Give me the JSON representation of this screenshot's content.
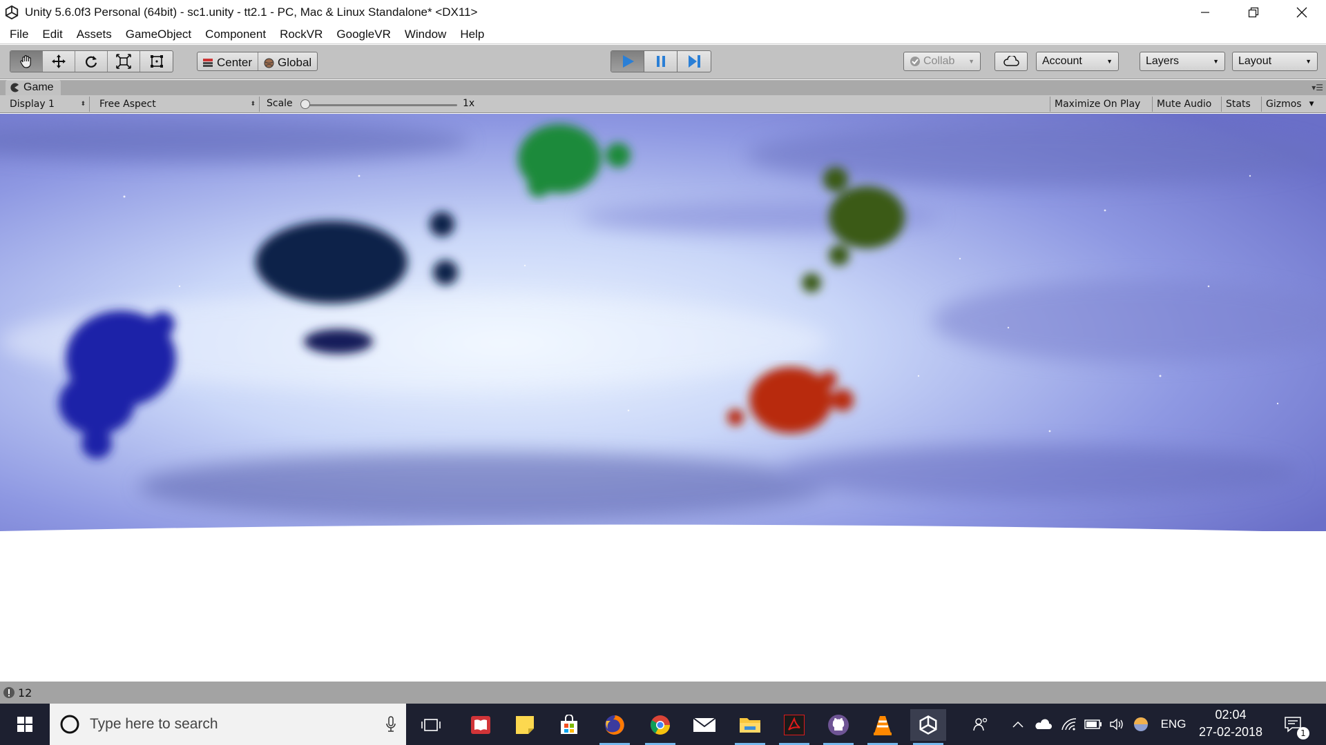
{
  "window": {
    "title": "Unity 5.6.0f3 Personal (64bit) - sc1.unity - tt2.1 - PC, Mac & Linux Standalone* <DX11>"
  },
  "menu": {
    "items": [
      "File",
      "Edit",
      "Assets",
      "GameObject",
      "Component",
      "RockVR",
      "GoogleVR",
      "Window",
      "Help"
    ]
  },
  "toolbar": {
    "transform_tools": [
      "hand-icon",
      "move-icon",
      "rotate-icon",
      "scale-icon",
      "rect-tool-icon"
    ],
    "pivot_label": "Center",
    "space_label": "Global",
    "play_active": true,
    "collab_label": "Collab",
    "account_label": "Account",
    "layers_label": "Layers",
    "layout_label": "Layout"
  },
  "game_tab": {
    "label": "Game"
  },
  "game_controls": {
    "display": "Display 1",
    "aspect": "Free Aspect",
    "scale_label": "Scale",
    "scale_value": "1x",
    "scale_level": 0,
    "maximize_label": "Maximize On Play",
    "mute_label": "Mute Audio",
    "stats_label": "Stats",
    "gizmos_label": "Gizmos"
  },
  "status": {
    "count": "12"
  },
  "taskbar": {
    "search_placeholder": "Type here to search",
    "apps": [
      "task-view-icon",
      "reader-icon",
      "sticky-notes-icon",
      "store-icon",
      "firefox-icon",
      "chrome-icon",
      "mail-icon",
      "file-explorer-icon",
      "acrobat-icon",
      "github-icon",
      "vlc-icon",
      "unity-icon"
    ],
    "language": "ENG",
    "time": "02:04",
    "date": "27-02-2018",
    "notification_count": "1"
  },
  "colors": {
    "accent_blue": "#2a7fd6",
    "editor_grey": "#c2c2c2",
    "taskbar_bg": "#1d2030"
  }
}
